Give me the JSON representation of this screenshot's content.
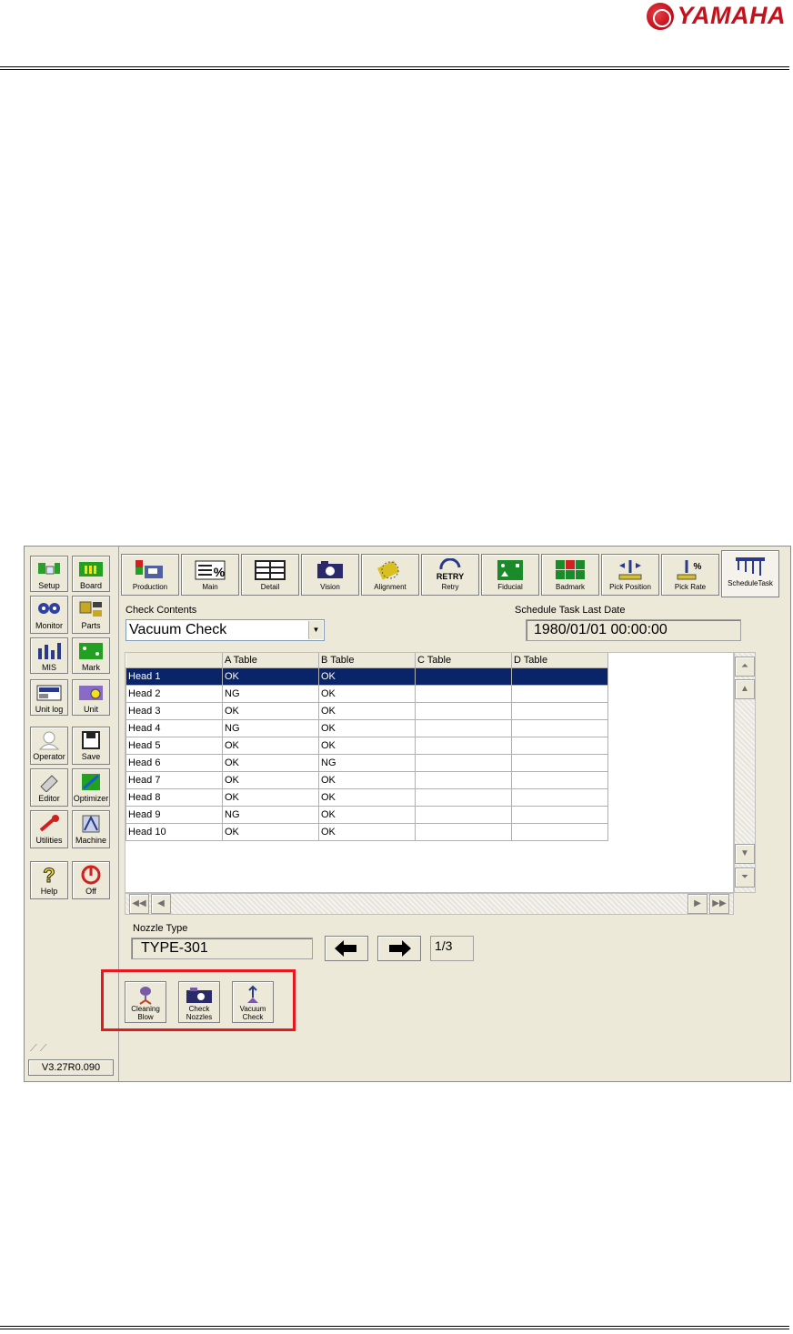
{
  "brand": {
    "logo_text": "YAMAHA"
  },
  "sidebar": {
    "items": [
      {
        "label": "Setup"
      },
      {
        "label": "Board"
      },
      {
        "label": "Monitor"
      },
      {
        "label": "Parts"
      },
      {
        "label": "MIS"
      },
      {
        "label": "Mark"
      },
      {
        "label": "Unit log"
      },
      {
        "label": "Unit"
      },
      {
        "label": "Operator"
      },
      {
        "label": "Save"
      },
      {
        "label": "Editor"
      },
      {
        "label": "Optimizer"
      },
      {
        "label": "Utilities"
      },
      {
        "label": "Machine"
      },
      {
        "label": "Help"
      },
      {
        "label": "Off"
      }
    ],
    "version": "V3.27R0.090"
  },
  "tabs": [
    {
      "label": "Production"
    },
    {
      "label": "Main"
    },
    {
      "label": "Detail"
    },
    {
      "label": "Vision"
    },
    {
      "label": "Alignment"
    },
    {
      "label": "Retry",
      "icon_text": "RETRY"
    },
    {
      "label": "Fiducial"
    },
    {
      "label": "Badmark"
    },
    {
      "label": "Pick Position"
    },
    {
      "label": "Pick Rate"
    },
    {
      "label": "ScheduleTask",
      "active": true
    }
  ],
  "check_contents": {
    "label": "Check Contents",
    "value": "Vacuum Check"
  },
  "last_date": {
    "label": "Schedule Task Last Date",
    "value": "1980/01/01 00:00:00"
  },
  "table": {
    "headers": [
      "",
      "A Table",
      "B Table",
      "C Table",
      "D Table"
    ],
    "rows": [
      [
        "Head 1",
        "OK",
        "OK",
        "",
        ""
      ],
      [
        "Head 2",
        "NG",
        "OK",
        "",
        ""
      ],
      [
        "Head 3",
        "OK",
        "OK",
        "",
        ""
      ],
      [
        "Head 4",
        "NG",
        "OK",
        "",
        ""
      ],
      [
        "Head 5",
        "OK",
        "OK",
        "",
        ""
      ],
      [
        "Head 6",
        "OK",
        "NG",
        "",
        ""
      ],
      [
        "Head 7",
        "OK",
        "OK",
        "",
        ""
      ],
      [
        "Head 8",
        "OK",
        "OK",
        "",
        ""
      ],
      [
        "Head 9",
        "NG",
        "OK",
        "",
        ""
      ],
      [
        "Head 10",
        "OK",
        "OK",
        "",
        ""
      ]
    ],
    "selected_row": 0
  },
  "nozzle": {
    "label": "Nozzle Type",
    "value": "TYPE-301",
    "page": "1/3"
  },
  "tools": [
    {
      "label_line1": "Cleaning",
      "label_line2": "Blow"
    },
    {
      "label_line1": "Check",
      "label_line2": "Nozzles"
    },
    {
      "label_line1": "Vacuum",
      "label_line2": "Check"
    }
  ],
  "colors": {
    "brand_red": "#c4121c",
    "highlight_red": "#e8171d",
    "selection_blue": "#0a246a",
    "window_bg": "#ece9d8"
  }
}
